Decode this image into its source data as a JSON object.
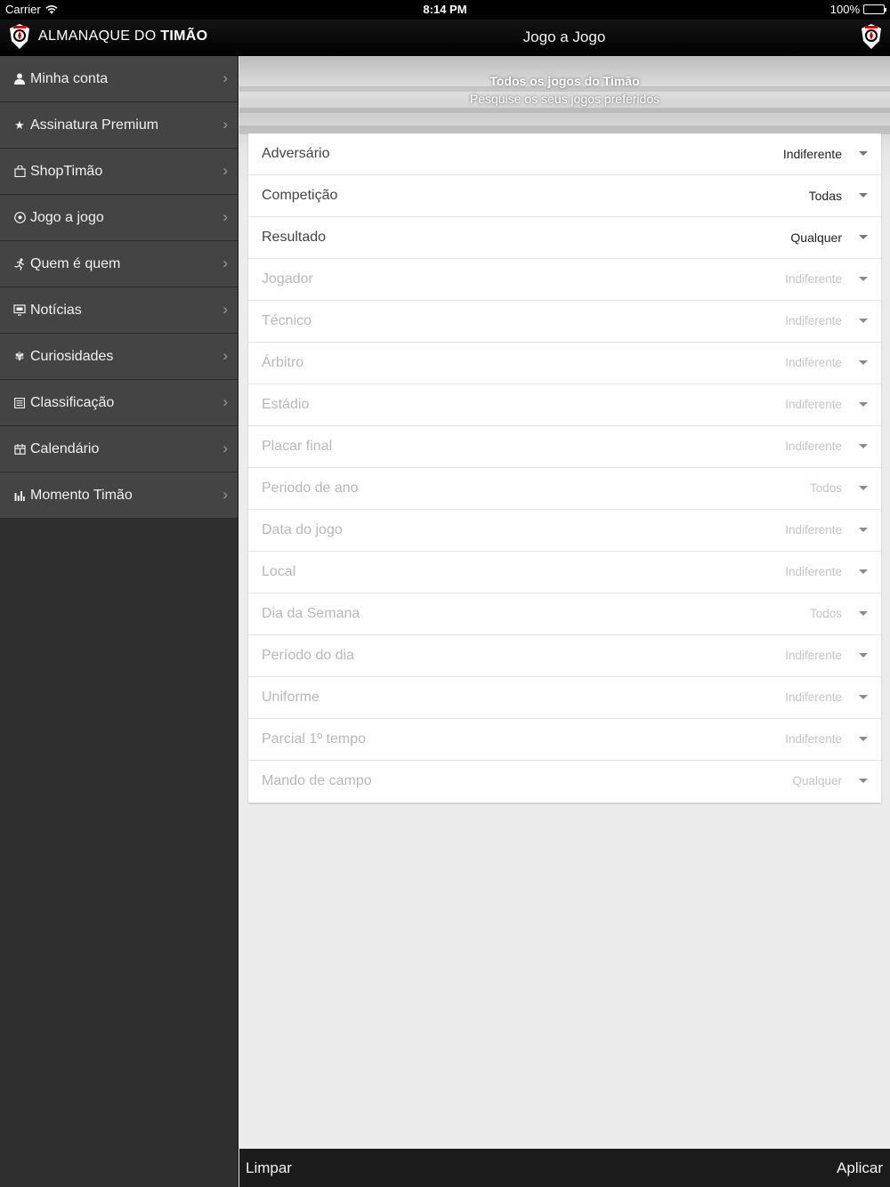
{
  "status_bar": {
    "carrier": "Carrier",
    "time": "8:14 PM",
    "battery": "100%"
  },
  "header": {
    "brand_light": "ALMANAQUE DO ",
    "brand_bold": "TIMÃO",
    "title": "Jogo a Jogo"
  },
  "sidebar": {
    "items": [
      {
        "label": "Minha conta",
        "icon": "person-icon"
      },
      {
        "label": "Assinatura Premium",
        "icon": "star-icon"
      },
      {
        "label": "ShopTimão",
        "icon": "shopping-bag-icon"
      },
      {
        "label": "Jogo a jogo",
        "icon": "soccer-ball-icon"
      },
      {
        "label": "Quem é quem",
        "icon": "running-player-icon"
      },
      {
        "label": "Notícias",
        "icon": "monitor-icon"
      },
      {
        "label": "Curiosidades",
        "icon": "flower-icon"
      },
      {
        "label": "Classificação",
        "icon": "table-list-icon"
      },
      {
        "label": "Calendário",
        "icon": "calendar-icon"
      },
      {
        "label": "Momento Timão",
        "icon": "bar-chart-icon"
      }
    ]
  },
  "banner": {
    "title": "Todos os jogos do Timão",
    "subtitle": "Pesquise os seus jogos preferidos"
  },
  "filters": [
    {
      "label": "Adversário",
      "value": "Indiferente",
      "enabled": true
    },
    {
      "label": "Competição",
      "value": "Todas",
      "enabled": true
    },
    {
      "label": "Resultado",
      "value": "Qualquer",
      "enabled": true
    },
    {
      "label": "Jogador",
      "value": "Indiferente",
      "enabled": false
    },
    {
      "label": "Técnico",
      "value": "Indiferente",
      "enabled": false
    },
    {
      "label": "Árbitro",
      "value": "Indiferente",
      "enabled": false
    },
    {
      "label": "Estádio",
      "value": "Indiferente",
      "enabled": false
    },
    {
      "label": "Placar final",
      "value": "Indiferente",
      "enabled": false
    },
    {
      "label": "Periodo de ano",
      "value": "Todos",
      "enabled": false
    },
    {
      "label": "Data do jogo",
      "value": "Indiferente",
      "enabled": false
    },
    {
      "label": "Local",
      "value": "Indiferente",
      "enabled": false
    },
    {
      "label": "Dia da Semana",
      "value": "Todos",
      "enabled": false
    },
    {
      "label": "Período do dia",
      "value": "Indiferente",
      "enabled": false
    },
    {
      "label": "Uniforme",
      "value": "Indiferente",
      "enabled": false
    },
    {
      "label": "Parcial 1º tempo",
      "value": "Indiferente",
      "enabled": false
    },
    {
      "label": "Mando de campo",
      "value": "Qualquer",
      "enabled": false
    }
  ],
  "bottom_bar": {
    "clear_label": "Limpar",
    "apply_label": "Aplicar"
  },
  "colors": {
    "sidebar_bg": "#2f2f2f",
    "menu_item_bg": "#444444",
    "header_bg": "#000000",
    "bottom_bar_bg": "#1b1b1b"
  }
}
